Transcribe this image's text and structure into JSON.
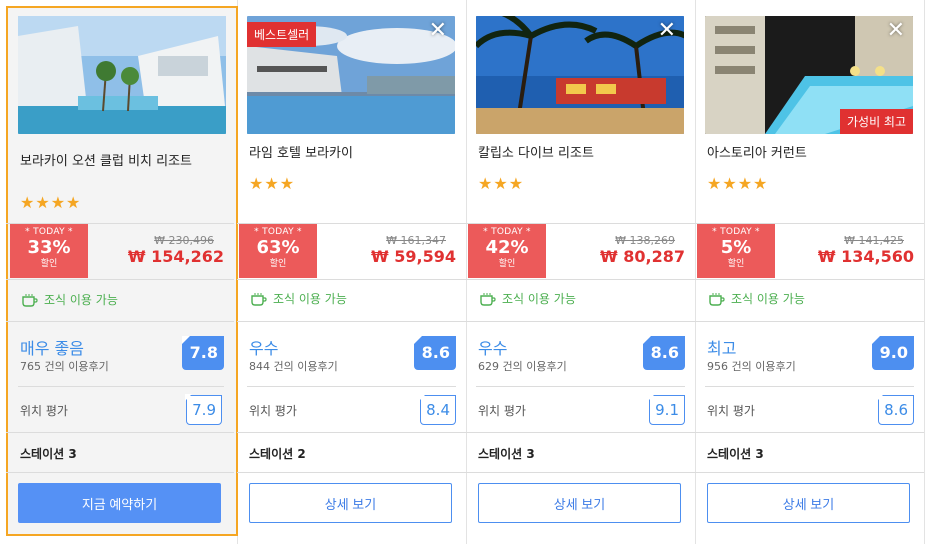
{
  "hotels": [
    {
      "name": "보라카이 오션 클럽 비치 리조트",
      "stars": "★★★★",
      "today_label": "* TODAY *",
      "discount": "33%",
      "discount_suffix": "할인",
      "original_price": "₩ 230,496",
      "sale_price": "₩ 154,262",
      "breakfast": "조식 이용 가능",
      "rating_word": "매우 좋음",
      "reviews": "765 건의 이용후기",
      "score": "7.8",
      "location_label": "위치 평가",
      "location_score": "7.9",
      "station": "스테이션 3",
      "button": "지금 예약하기",
      "badge": "",
      "photo": "beach-resort"
    },
    {
      "name": "라임 호텔 보라카이",
      "stars": "★★★",
      "today_label": "* TODAY *",
      "discount": "63%",
      "discount_suffix": "할인",
      "original_price": "₩ 161,347",
      "sale_price": "₩ 59,594",
      "breakfast": "조식 이용 가능",
      "rating_word": "우수",
      "reviews": "844 건의 이용후기",
      "score": "8.6",
      "location_label": "위치 평가",
      "location_score": "8.4",
      "station": "스테이션 2",
      "button": "상세 보기",
      "badge": "베스트셀러",
      "photo": "rooftop-pool"
    },
    {
      "name": "칼립소 다이브 리조트",
      "stars": "★★★",
      "today_label": "* TODAY *",
      "discount": "42%",
      "discount_suffix": "할인",
      "original_price": "₩ 138,269",
      "sale_price": "₩ 80,287",
      "breakfast": "조식 이용 가능",
      "rating_word": "우수",
      "reviews": "629 건의 이용후기",
      "score": "8.6",
      "location_label": "위치 평가",
      "location_score": "9.1",
      "station": "스테이션 3",
      "button": "상세 보기",
      "badge": "",
      "photo": "palm-beach"
    },
    {
      "name": "아스토리아 커런트",
      "stars": "★★★★",
      "today_label": "* TODAY *",
      "discount": "5%",
      "discount_suffix": "할인",
      "original_price": "₩ 141,425",
      "sale_price": "₩ 134,560",
      "breakfast": "조식 이용 가능",
      "rating_word": "최고",
      "reviews": "956 건의 이용후기",
      "score": "9.0",
      "location_label": "위치 평가",
      "location_score": "8.6",
      "station": "스테이션 3",
      "button": "상세 보기",
      "badge": "가성비 최고",
      "photo": "night-pool"
    }
  ],
  "close_glyph": "✕",
  "colors": {
    "accent": "#5591f5",
    "sale": "#e03131",
    "discount_bg": "#ec5a5a",
    "breakfast": "#4caf50",
    "selected_border": "#f5a623",
    "star": "#f5a623"
  }
}
